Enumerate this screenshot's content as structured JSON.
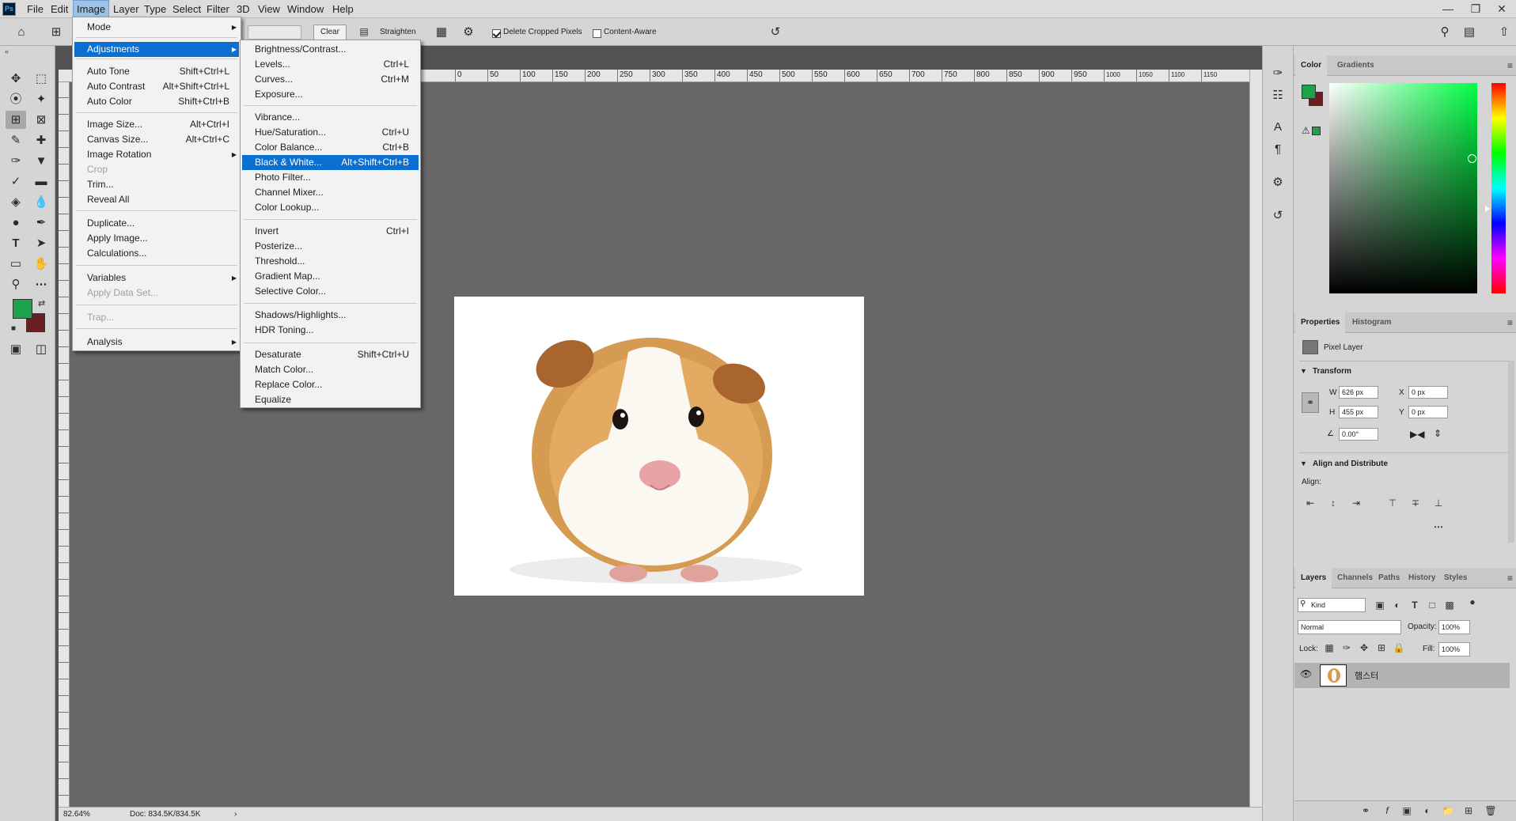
{
  "app": {
    "logo": "Ps"
  },
  "menubar": {
    "items": [
      "File",
      "Edit",
      "Image",
      "Layer",
      "Type",
      "Select",
      "Filter",
      "3D",
      "View",
      "Window",
      "Help"
    ]
  },
  "options": {
    "clear": "Clear",
    "straighten": "Straighten",
    "delete_cropped": "Delete Cropped Pixels",
    "content_aware": "Content-Aware"
  },
  "image_menu": {
    "items": [
      {
        "label": "Mode",
        "shortcut": "",
        "submenu": true
      },
      {
        "label": "Adjustments",
        "shortcut": "",
        "submenu": true
      },
      {
        "label": "Auto Tone",
        "shortcut": "Shift+Ctrl+L"
      },
      {
        "label": "Auto Contrast",
        "shortcut": "Alt+Shift+Ctrl+L"
      },
      {
        "label": "Auto Color",
        "shortcut": "Shift+Ctrl+B"
      },
      {
        "label": "Image Size...",
        "shortcut": "Alt+Ctrl+I"
      },
      {
        "label": "Canvas Size...",
        "shortcut": "Alt+Ctrl+C"
      },
      {
        "label": "Image Rotation",
        "shortcut": "",
        "submenu": true
      },
      {
        "label": "Crop",
        "shortcut": "",
        "disabled": true
      },
      {
        "label": "Trim...",
        "shortcut": ""
      },
      {
        "label": "Reveal All",
        "shortcut": ""
      },
      {
        "label": "Duplicate...",
        "shortcut": ""
      },
      {
        "label": "Apply Image...",
        "shortcut": ""
      },
      {
        "label": "Calculations...",
        "shortcut": ""
      },
      {
        "label": "Variables",
        "shortcut": "",
        "submenu": true
      },
      {
        "label": "Apply Data Set...",
        "shortcut": "",
        "disabled": true
      },
      {
        "label": "Trap...",
        "shortcut": "",
        "disabled": true
      },
      {
        "label": "Analysis",
        "shortcut": "",
        "submenu": true
      }
    ]
  },
  "adj_menu": {
    "items": [
      {
        "label": "Brightness/Contrast...",
        "shortcut": ""
      },
      {
        "label": "Levels...",
        "shortcut": "Ctrl+L"
      },
      {
        "label": "Curves...",
        "shortcut": "Ctrl+M"
      },
      {
        "label": "Exposure...",
        "shortcut": ""
      },
      {
        "label": "Vibrance...",
        "shortcut": ""
      },
      {
        "label": "Hue/Saturation...",
        "shortcut": "Ctrl+U"
      },
      {
        "label": "Color Balance...",
        "shortcut": "Ctrl+B"
      },
      {
        "label": "Black & White...",
        "shortcut": "Alt+Shift+Ctrl+B"
      },
      {
        "label": "Photo Filter...",
        "shortcut": ""
      },
      {
        "label": "Channel Mixer...",
        "shortcut": ""
      },
      {
        "label": "Color Lookup...",
        "shortcut": ""
      },
      {
        "label": "Invert",
        "shortcut": "Ctrl+I"
      },
      {
        "label": "Posterize...",
        "shortcut": ""
      },
      {
        "label": "Threshold...",
        "shortcut": ""
      },
      {
        "label": "Gradient Map...",
        "shortcut": ""
      },
      {
        "label": "Selective Color...",
        "shortcut": ""
      },
      {
        "label": "Shadows/Highlights...",
        "shortcut": ""
      },
      {
        "label": "HDR Toning...",
        "shortcut": ""
      },
      {
        "label": "Desaturate",
        "shortcut": "Shift+Ctrl+U"
      },
      {
        "label": "Match Color...",
        "shortcut": ""
      },
      {
        "label": "Replace Color...",
        "shortcut": ""
      },
      {
        "label": "Equalize",
        "shortcut": ""
      }
    ]
  },
  "ruler_top": [
    "450",
    "0",
    "50",
    "100",
    "150",
    "200",
    "250",
    "300",
    "350",
    "400",
    "450",
    "500",
    "550",
    "600",
    "650",
    "700",
    "750",
    "800",
    "850",
    "900",
    "950",
    "1000",
    "1050",
    "1100",
    "1150"
  ],
  "status": {
    "zoom": "82.64%",
    "doc": "Doc: 834.5K/834.5K"
  },
  "color_panel": {
    "tabs": [
      "Color",
      "Gradients"
    ],
    "fg": "#1aa34a",
    "bg": "#6b1f23"
  },
  "properties": {
    "tabs": [
      "Properties",
      "Histogram"
    ],
    "layer_type": "Pixel Layer",
    "transform": "Transform",
    "w": "626 px",
    "h": "455 px",
    "x": "0 px",
    "y": "0 px",
    "angle": "0.00°",
    "w_lbl": "W",
    "h_lbl": "H",
    "x_lbl": "X",
    "y_lbl": "Y",
    "align_section": "Align and Distribute",
    "align_lbl": "Align:"
  },
  "layers": {
    "tabs": [
      "Layers",
      "Channels",
      "Paths",
      "History",
      "Styles"
    ],
    "kind": "Kind",
    "blend": "Normal",
    "opacity_lbl": "Opacity:",
    "opacity": "100%",
    "lock_lbl": "Lock:",
    "fill_lbl": "Fill:",
    "fill": "100%",
    "layer_name": "햄스터"
  }
}
